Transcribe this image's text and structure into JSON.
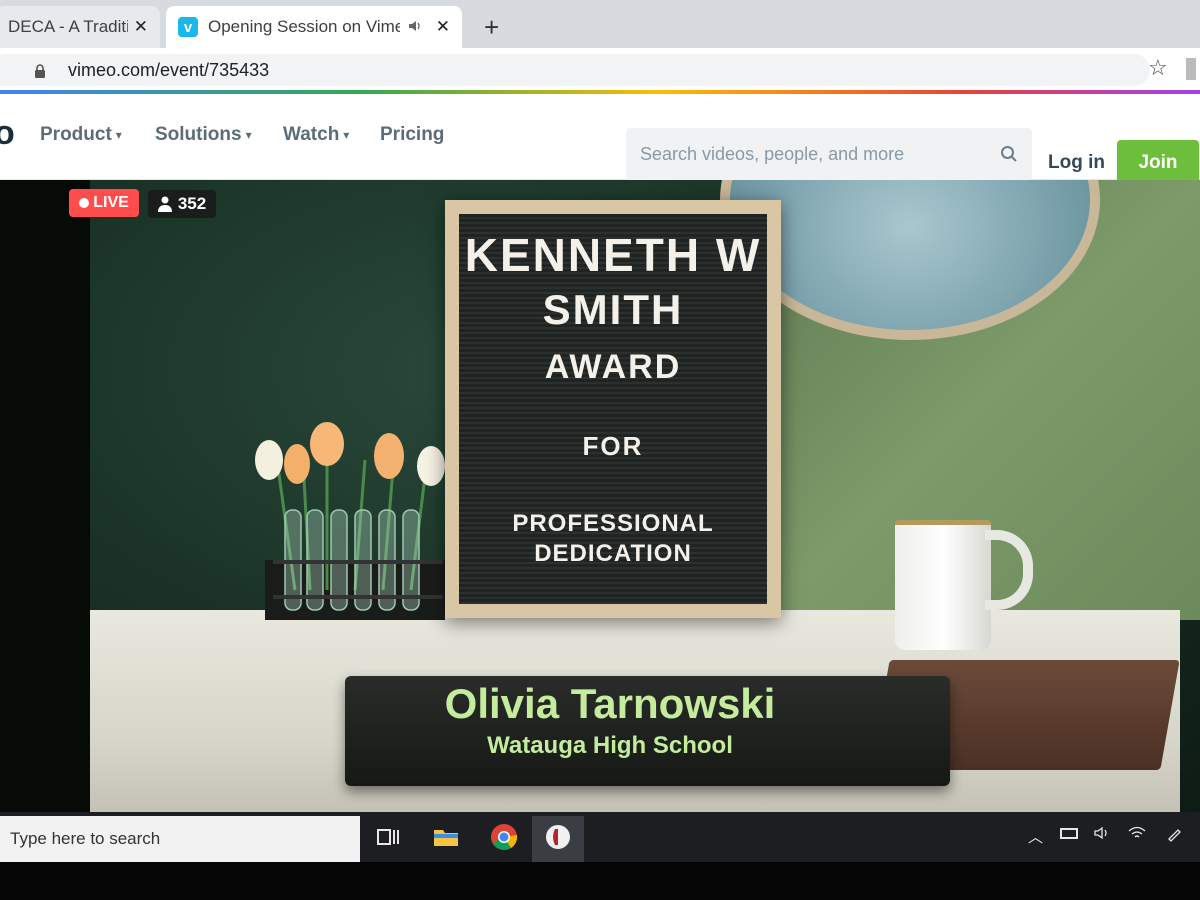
{
  "browser": {
    "tabs": [
      {
        "title": "DECA - A Tradition",
        "close": "✕"
      },
      {
        "title": "Opening Session on Vimeo",
        "close": "✕",
        "favicon": "v"
      }
    ],
    "new_tab": "+",
    "url": "vimeo.com/event/735433",
    "star": "☆"
  },
  "vimeo_nav": {
    "logo_fragment": "o",
    "items": [
      {
        "label": "Product"
      },
      {
        "label": "Solutions"
      },
      {
        "label": "Watch"
      },
      {
        "label": "Pricing"
      }
    ],
    "search_placeholder": "Search videos, people, and more",
    "login": "Log in",
    "join": "Join",
    "join_color": "#6cbe3c"
  },
  "video": {
    "live_label": "LIVE",
    "live_color": "#ff4d4d",
    "viewer_count": "352",
    "board": {
      "line1": "KENNETH W",
      "line2": "SMITH",
      "line3": "AWARD",
      "line4": "FOR",
      "line5": "PROFESSIONAL",
      "line6": "DEDICATION"
    },
    "lower_third": {
      "name": "Olivia Tarnowski",
      "school": "Watauga High School",
      "text_color": "#c4ec9c"
    }
  },
  "taskbar": {
    "search_placeholder": "Type here to search",
    "icons": [
      "task-view-icon",
      "file-explorer-icon",
      "chrome-icon",
      "app-icon"
    ],
    "tray": [
      "chevron-up-icon",
      "battery-icon",
      "volume-icon",
      "wifi-icon",
      "pen-icon"
    ]
  }
}
